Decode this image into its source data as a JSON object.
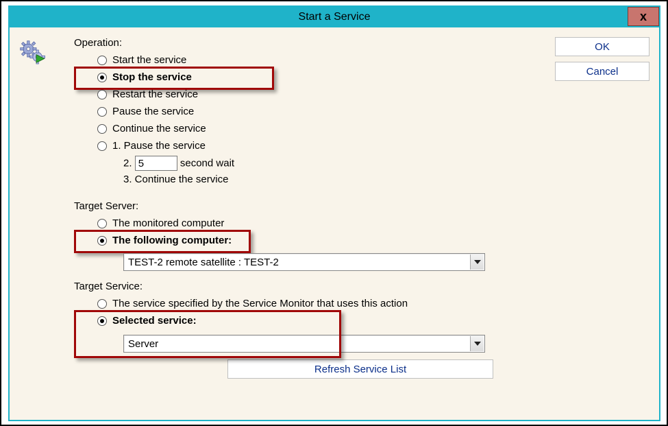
{
  "window": {
    "title": "Start a Service",
    "close_label": "x"
  },
  "buttons": {
    "ok": "OK",
    "cancel": "Cancel"
  },
  "operation": {
    "label": "Operation:",
    "options": {
      "start": "Start the service",
      "stop": "Stop the service",
      "restart": "Restart the service",
      "pause": "Pause the service",
      "continue": "Continue the service",
      "combo_1": "1. Pause the service",
      "combo_2_prefix": "2.",
      "combo_2_suffix": "second wait",
      "combo_2_value": "5",
      "combo_3": "3. Continue the service"
    },
    "selected": "stop"
  },
  "target_server": {
    "label": "Target Server:",
    "options": {
      "monitored": "The monitored computer",
      "following": "The following computer:"
    },
    "selected": "following",
    "computer_value": "TEST-2 remote satellite : TEST-2"
  },
  "target_service": {
    "label": "Target Service:",
    "options": {
      "by_monitor": "The service specified by the Service Monitor that uses this action",
      "selected_service": "Selected service:"
    },
    "selected": "selected_service",
    "service_value": "Server",
    "refresh_label": "Refresh Service List"
  },
  "icons": {
    "gears": "gears-play-icon",
    "close": "close-icon"
  }
}
